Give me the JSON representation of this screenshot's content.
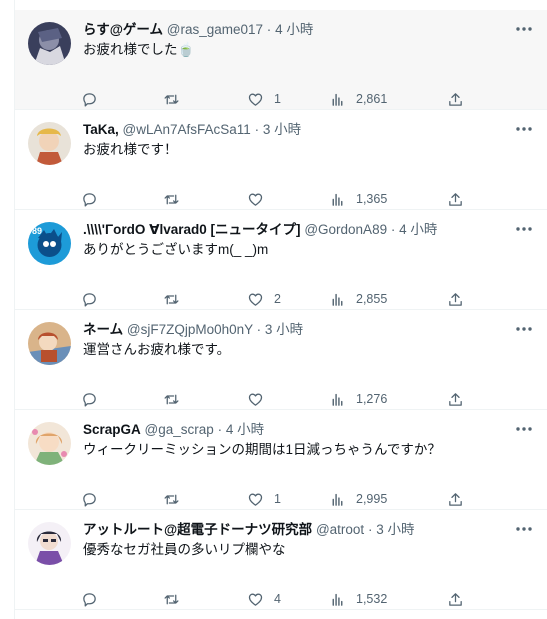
{
  "replies": [
    {
      "display_name": "らす@ゲーム",
      "handle": "@ras_game017",
      "time": "4 小時",
      "text": "お疲れ様でした🍵",
      "likes": "1",
      "views": "2,861",
      "avatar_colors": [
        "#3a3f5c",
        "#8c8fa8",
        "#d8d8e0"
      ]
    },
    {
      "display_name": "TaKa,",
      "handle": "@wLAn7AfsFAcSa11",
      "time": "3 小時",
      "text": "お疲れ様です！",
      "likes": "",
      "views": "1,365",
      "avatar_colors": [
        "#e8e2d8",
        "#c25a3a",
        "#e6b84a"
      ]
    },
    {
      "display_name": ".\\\\\\\\'ΓordO ∀lvarad0 [ニュータイプ]",
      "handle": "@GordonA89",
      "time": "4 小時",
      "text": "ありがとうございますm(_ _)m",
      "likes": "2",
      "views": "2,855",
      "avatar_colors": [
        "#1d9bd8",
        "#0b4f8a",
        "#ffffff"
      ]
    },
    {
      "display_name": "ネーム",
      "handle": "@sjF7ZQjpMo0h0nY",
      "time": "3 小時",
      "text": "運営さんお疲れ様です。",
      "likes": "",
      "views": "1,276",
      "avatar_colors": [
        "#d9b48a",
        "#b8502e",
        "#6a8fb8"
      ]
    },
    {
      "display_name": "ScrapGA",
      "handle": "@ga_scrap",
      "time": "4 小時",
      "text": "ウィークリーミッションの期間は1日減っちゃうんですか？",
      "likes": "1",
      "views": "2,995",
      "avatar_colors": [
        "#f2e6d8",
        "#e0a46a",
        "#7fb27a"
      ]
    },
    {
      "display_name": "アットルート@超電子ドーナツ研究部",
      "handle": "@atroot",
      "time": "3 小時",
      "text": "優秀なセガ社員の多いリプ欄やな",
      "likes": "4",
      "views": "1,532",
      "avatar_colors": [
        "#f4f0f6",
        "#7a4fa8",
        "#2a2a3a"
      ]
    }
  ],
  "separator": "·",
  "icon_color": "#536471",
  "icons": {
    "reply": "speech-bubble-icon",
    "retweet": "retweet-arrows-icon",
    "like": "heart-icon",
    "views": "bar-chart-icon",
    "share": "share-upload-icon",
    "more": "three-dots-icon"
  }
}
